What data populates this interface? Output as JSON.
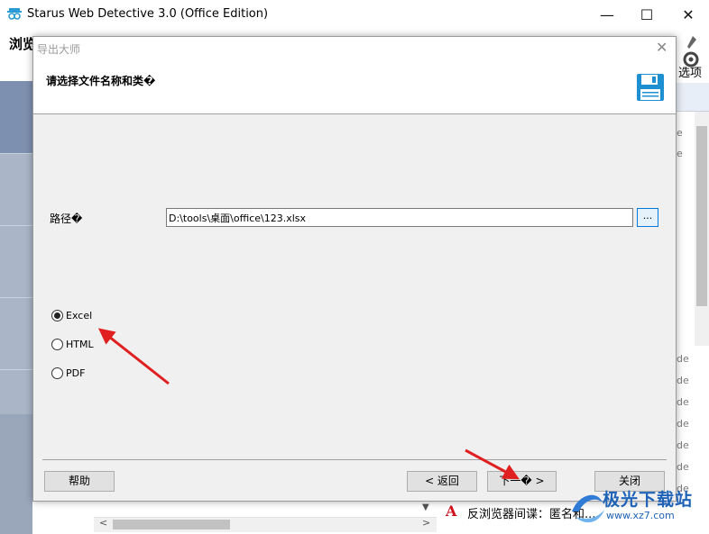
{
  "window": {
    "title": "Starus Web Detective 3.0 (Office Edition)",
    "min_glyph": "—",
    "max_glyph": "☐",
    "close_glyph": "✕"
  },
  "toolbar": {
    "left_text": "浏览历",
    "right_text": "选项"
  },
  "dialog": {
    "title": "导出大师",
    "heading": "请选择文件名称和类�",
    "close_glyph": "✕",
    "path_label": "路径�",
    "path_value": "D:\\tools\\桌面\\office\\123.xlsx",
    "browse_label": "...",
    "formats": [
      {
        "label": "Excel",
        "checked": true
      },
      {
        "label": "HTML",
        "checked": false
      },
      {
        "label": "PDF",
        "checked": false
      }
    ],
    "buttons": {
      "help": "帮助",
      "back": "< 返回",
      "next": "下一� >",
      "close": "关闭"
    }
  },
  "side_list": {
    "items": [
      "de",
      "de",
      "de",
      "de",
      "de",
      "de",
      "de",
      "de"
    ],
    "top_items": [
      "e",
      "e"
    ]
  },
  "status": {
    "icon_letter": "A",
    "text": "反浏览器间谍：匿名和..."
  },
  "watermark": {
    "text": "极光下载站",
    "url": "www.xz7.com"
  },
  "colors": {
    "accent": "#0078d7",
    "arrow": "#e02020",
    "left_pane": "#aab6c8"
  }
}
